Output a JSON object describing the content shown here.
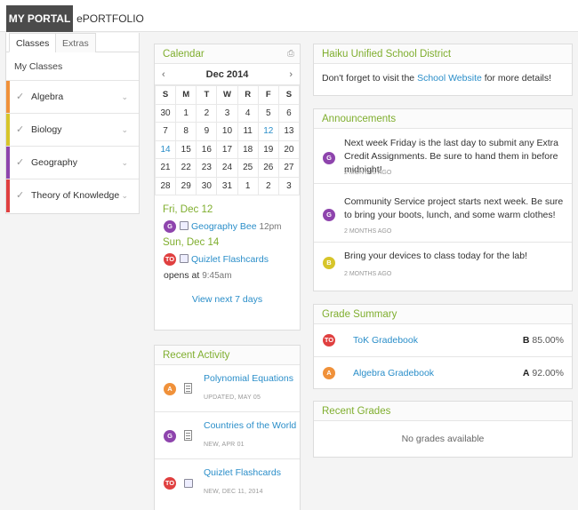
{
  "topnav": {
    "portal": "MY PORTAL",
    "portfolio": "ePORTFOLIO"
  },
  "sidebar": {
    "tabs": [
      "Classes",
      "Extras"
    ],
    "heading": "My Classes",
    "classes": [
      {
        "name": "Algebra",
        "color": "#f0913a"
      },
      {
        "name": "Biology",
        "color": "#d7c52a"
      },
      {
        "name": "Geography",
        "color": "#8e44ad"
      },
      {
        "name": "Theory of Knowledge",
        "color": "#e04040"
      }
    ]
  },
  "calendar": {
    "title": "Calendar",
    "month": "Dec 2014",
    "prev": "‹",
    "next": "›",
    "weekdays": [
      "S",
      "M",
      "T",
      "W",
      "R",
      "F",
      "S"
    ],
    "weeks": [
      [
        "30",
        "1",
        "2",
        "3",
        "4",
        "5",
        "6"
      ],
      [
        "7",
        "8",
        "9",
        "10",
        "11",
        "12",
        "13"
      ],
      [
        "14",
        "15",
        "16",
        "17",
        "18",
        "19",
        "20"
      ],
      [
        "21",
        "22",
        "23",
        "24",
        "25",
        "26",
        "27"
      ],
      [
        "28",
        "29",
        "30",
        "31",
        "1",
        "2",
        "3"
      ]
    ],
    "events": [
      {
        "day": "Fri, Dec 12",
        "avatar": "G",
        "avatar_color": "#8e44ad",
        "title": "Geography Bee",
        "time": "12pm"
      },
      {
        "day": "Sun, Dec 14",
        "avatar": "TO",
        "avatar_color": "#e04040",
        "title": "Quizlet Flashcards",
        "opens": "opens at",
        "time": "9:45am"
      }
    ],
    "view_next": "View next 7 days"
  },
  "activity": {
    "title": "Recent Activity",
    "items": [
      {
        "avatar": "A",
        "avatar_color": "#f0913a",
        "title": "Polynomial Equations",
        "meta": "UPDATED, MAY 05"
      },
      {
        "avatar": "G",
        "avatar_color": "#8e44ad",
        "title": "Countries of the World",
        "meta": "NEW, APR 01"
      },
      {
        "avatar": "TO",
        "avatar_color": "#e04040",
        "title": "Quizlet Flashcards",
        "meta": "NEW, DEC 11, 2014"
      }
    ]
  },
  "district": {
    "title": "Haiku Unified School District",
    "text_before": "Don't forget to visit the ",
    "link": "School Website",
    "text_after": " for more details!"
  },
  "announcements": {
    "title": "Announcements",
    "items": [
      {
        "avatar": "G",
        "avatar_color": "#8e44ad",
        "text": "Next week Friday is the last day to submit any Extra Credit Assignments. Be sure to hand them in before midnight!",
        "meta": "2 MONTHS AGO"
      },
      {
        "avatar": "G",
        "avatar_color": "#8e44ad",
        "text": "Community Service project starts next week. Be sure to bring your boots, lunch, and some warm clothes!",
        "meta": "2 MONTHS AGO"
      },
      {
        "avatar": "B",
        "avatar_color": "#d7c52a",
        "text": "Bring your devices to class today for the lab!",
        "meta": "2 MONTHS AGO"
      }
    ]
  },
  "grades": {
    "title": "Grade Summary",
    "items": [
      {
        "avatar": "TO",
        "avatar_color": "#e04040",
        "name": "ToK Gradebook",
        "letter": "B",
        "percent": "85.00%"
      },
      {
        "avatar": "A",
        "avatar_color": "#f0913a",
        "name": "Algebra Gradebook",
        "letter": "A",
        "percent": "92.00%"
      }
    ]
  },
  "recent_grades": {
    "title": "Recent Grades",
    "empty": "No grades available"
  },
  "icons": {
    "check": "check-icon",
    "chevron": "chevron-down-icon",
    "print": "print-icon",
    "calendar_event": "event-icon",
    "document": "document-icon"
  }
}
